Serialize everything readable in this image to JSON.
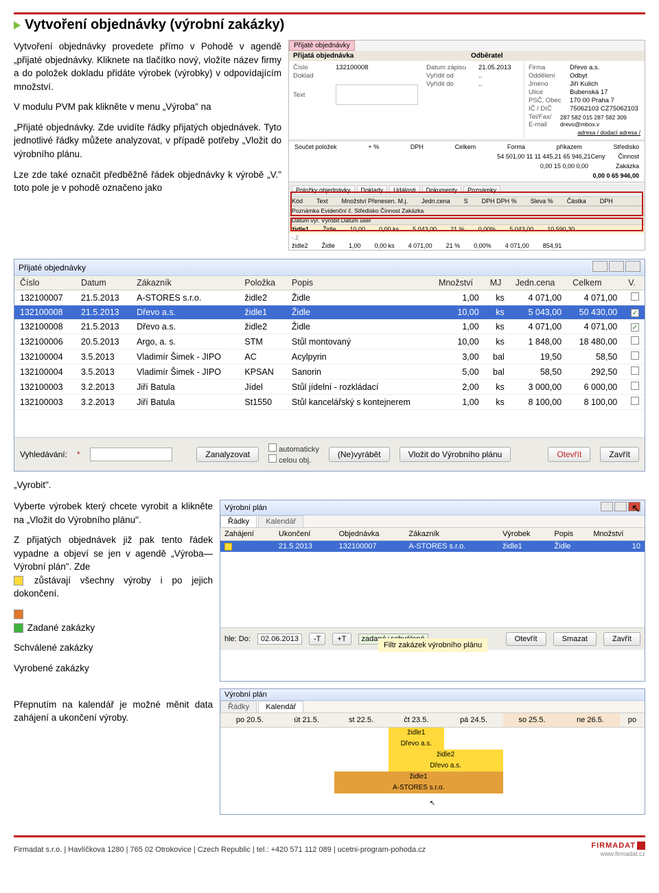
{
  "heading": "Vytvoření objednávky (výrobní zakázky)",
  "intro": {
    "p1": "Vytvoření objednávky provedete přímo v Pohodě v agendě „přijaté objednávky. Kliknete na tlačítko nový, vložíte název firmy a do položek dokladu přidáte výrobek (výrobky) v odpovídajícím množství.",
    "p2": "V modulu PVM pak klikněte v menu „Výroba\" na",
    "p3": "„Přijaté objednávky. Zde uvidíte řádky přijatých objednávek. Tyto jednotlivé řádky můžete analyzovat, v případě potřeby „Vložit do výrobního plánu.",
    "p4": "Lze zde také označit předběžně řádek objednávky k výrobě „V.\" toto pole je v pohodě označeno jako"
  },
  "formTop": {
    "tab": "Přijaté objednávky",
    "sec1": "Přijatá objednávka",
    "sec2": "Odběratel",
    "cislo_l": "Číslo",
    "cislo_v": "132100008",
    "doklad_l": "Doklad",
    "datum_l": "Datum zápisu",
    "datum_v": "21.05.2013",
    "vyr_od_l": "Vyřídit od",
    "vyr_od_v": "..",
    "vyr_do_l": "Vyřídit do",
    "vyr_do_v": "..",
    "text_l": "Text",
    "firma_l": "Firma",
    "firma_v": "Dřevo a.s.",
    "odd_l": "Oddělení",
    "odd_v": "Odbyt",
    "jmeno_l": "Jméno",
    "jmeno_v": "Jiří Kulich",
    "ulice_l": "Ulice",
    "ulice_v": "Bubenská 17",
    "psc_l": "PSČ, Obec",
    "psc_v": "170 00   Praha 7",
    "ic_l": "IČ / DIČ",
    "ic_v": "75062103     CZ75062103",
    "tel_l": "Tel/Fax/ E-mail",
    "tel_v": "287 582 015    287 582 309     drevo@mbox.v",
    "adr_l": "adresa / dodací adresa /"
  },
  "sum": {
    "sp": "Součet položek",
    "plus": "+ %",
    "dph": "DPH",
    "celkem": "Celkem",
    "r1": "54 501,00   11   11 445,21   65 946,21",
    "r2": "0,00   15   0,00   0,00",
    "r3": "0,00   0            65 946,00",
    "forma": "Forma",
    "forma_v": "příkazem",
    "str": "Středisko",
    "cin": "Činnost",
    "ceny": "Ceny",
    "zak": "Zakázka"
  },
  "miniTabs": [
    "Položky objednávky",
    "Doklady",
    "Události",
    "Dokumenty",
    "Poznámky"
  ],
  "miniHead": {
    "kod": "Kód",
    "text": "Text",
    "mp": "Množství Přenesen. M.j.",
    "jc": "Jedn.cena",
    "s": "S",
    "dph": "DPH DPH %",
    "sl": "Sleva %",
    "cast": "Částka",
    "dph2": "DPH",
    "row2": "Poznámka           Evidenční č.   Středisko   Činnost   Zakázka",
    "row3": "Datum výr.  Výrobit  Datum user"
  },
  "miniRows": [
    {
      "kod": "židle1",
      "text": "Židle",
      "m": "10,00",
      "mj": "0,00  ks",
      "jc": "5 043,00",
      "dph": "21 %",
      "sl": "0,00%",
      "c": "5 043,00",
      "d": "10 590,30",
      "minus": "-,2"
    },
    {
      "kod": "židle2",
      "text": "Židle",
      "m": "1,00",
      "mj": "0,00  ks",
      "jc": "4 071,00",
      "dph": "21 %",
      "sl": "0,00%",
      "c": "4 071,00",
      "d": "854,91"
    }
  ],
  "ordersTitle": "Přijaté objednávky",
  "ordersCols": [
    "Číslo",
    "Datum",
    "Zákazník",
    "Položka",
    "Popis",
    "Množství",
    "MJ",
    "Jedn.cena",
    "Celkem",
    "V."
  ],
  "ordersRows": [
    {
      "c": "132100007",
      "d": "21.5.2013",
      "z": "A-STORES s.r.o.",
      "p": "židle2",
      "po": "Židle",
      "m": "1,00",
      "mj": "ks",
      "jc": "4 071,00",
      "ck": "4 071,00",
      "v": false
    },
    {
      "c": "132100008",
      "d": "21.5.2013",
      "z": "Dřevo a.s.",
      "p": "židle1",
      "po": "Židle",
      "m": "10,00",
      "mj": "ks",
      "jc": "5 043,00",
      "ck": "50 430,00",
      "v": true,
      "sel": true
    },
    {
      "c": "132100008",
      "d": "21.5.2013",
      "z": "Dřevo a.s.",
      "p": "židle2",
      "po": "Židle",
      "m": "1,00",
      "mj": "ks",
      "jc": "4 071,00",
      "ck": "4 071,00",
      "v": true
    },
    {
      "c": "132100006",
      "d": "20.5.2013",
      "z": "Argo, a. s.",
      "p": "STM",
      "po": "Stůl montovaný",
      "m": "10,00",
      "mj": "ks",
      "jc": "1 848,00",
      "ck": "18 480,00",
      "v": false
    },
    {
      "c": "132100004",
      "d": "3.5.2013",
      "z": "Vladimír Šimek - JIPO",
      "p": "AC",
      "po": "Acylpyrin",
      "m": "3,00",
      "mj": "bal",
      "jc": "19,50",
      "ck": "58,50",
      "v": false
    },
    {
      "c": "132100004",
      "d": "3.5.2013",
      "z": "Vladimír Šimek - JIPO",
      "p": "KPSAN",
      "po": "Sanorin",
      "m": "5,00",
      "mj": "bal",
      "jc": "58,50",
      "ck": "292,50",
      "v": false
    },
    {
      "c": "132100003",
      "d": "3.2.2013",
      "z": "Jiří Batula",
      "p": "Jídel",
      "po": "Stůl jídelní - rozkládací",
      "m": "2,00",
      "mj": "ks",
      "jc": "3 000,00",
      "ck": "6 000,00",
      "v": false
    },
    {
      "c": "132100003",
      "d": "3.2.2013",
      "z": "Jiří Batula",
      "p": "St1550",
      "po": "Stůl kancelářský s kontejnerem",
      "m": "1,00",
      "mj": "ks",
      "jc": "8 100,00",
      "ck": "8 100,00",
      "v": false
    }
  ],
  "ordersBottom": {
    "search_l": "Vyhledávání:",
    "btn_analyze": "Zanalyzovat",
    "chk_auto": "automaticky",
    "chk_whole": "celou obj.",
    "btn_nevyr": "(Ne)vyrábět",
    "btn_vlozit": "Vložit do Výrobního plánu",
    "btn_open": "Otevřít",
    "btn_close": "Zavřít"
  },
  "vyrobit": "„Vyrobit\".",
  "sec2": {
    "p1": "Vyberte výrobek který chcete vyrobit a klikněte na „Vložit do Výrobního plánu\".",
    "p2a": "Z přijatých objednávek již pak tento řádek vypadne a objeví se jen v agendě „Výroba—Výrobní plán\". Zde ",
    "p2b": "zůstávají všechny výroby i po jejich dokončení.",
    "zad": "Zadané zakázky",
    "sch": "Schválené zakázky",
    "vyr": "Vyrobené zakázky"
  },
  "plan": {
    "title": "Výrobní plán",
    "tab1": "Řádky",
    "tab2": "Kalendář",
    "cols": [
      "Zahájení",
      "Ukončení",
      "Objednávka",
      "Zákazník",
      "Výrobek",
      "Popis",
      "Množství"
    ],
    "row": {
      "zah": "",
      "uk": "21.5.2013",
      "obj": "132100007",
      "zak": "A-STORES s.r.o.",
      "vyr": "židle1",
      "pop": "Židle",
      "m": "10"
    },
    "bottom": {
      "hledo": "hle: Do:",
      "date": "02.06.2013",
      "tm": "-T",
      "tp": "+T",
      "sel": "zadané+schválené",
      "open": "Otevřít",
      "del": "Smazat",
      "close": "Zavřít"
    },
    "callout": "Filtr zakázek výrobního plánu"
  },
  "sec3txt": "Přepnutím na kalendář je možné měnit data zahájení a ukončení výroby.",
  "cal": {
    "title": "Výrobní plán",
    "tab1": "Řádky",
    "tab2": "Kalendář",
    "days": [
      "po 20.5.",
      "út 21.5.",
      "st 22.5.",
      "čt 23.5.",
      "pá 24.5.",
      "so 25.5.",
      "ne 26.5.",
      "po"
    ],
    "g1a": "židle1",
    "g1b": "Dřevo a.s.",
    "g2a": "židle2",
    "g2b": "Dřevo a.s.",
    "g3a": "židle1",
    "g3b": "A-STORES s.r.o."
  },
  "footer": {
    "left": "Firmadat s.r.o. | Havlíčkova 1280 | 765 02 Otrokovice | Czech Republic | tel.: +420 571 112 089 | ucetni-program-pohoda.cz",
    "brand": "FIRMADAT",
    "url": "www.firmadat.cz"
  }
}
